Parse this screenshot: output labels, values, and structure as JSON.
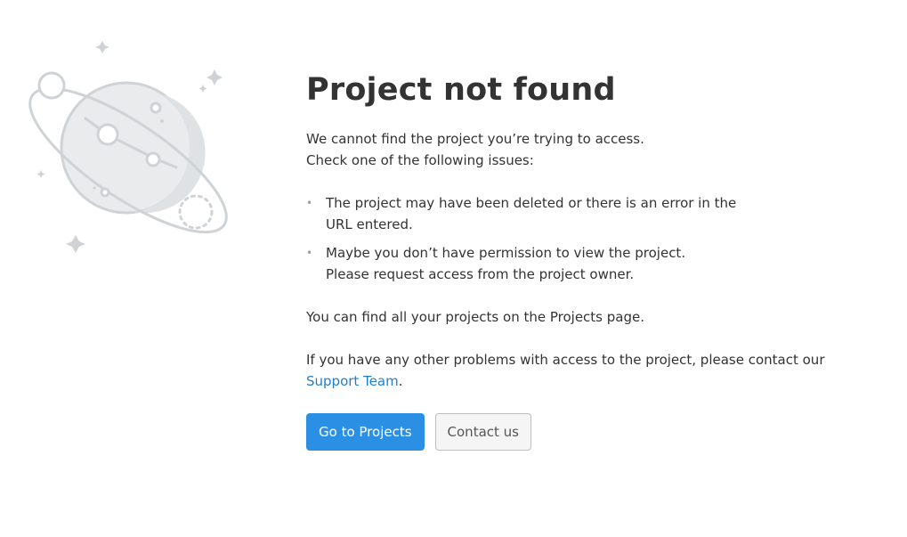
{
  "page": {
    "title": "Project not found",
    "intro_line1": "We cannot find the project you’re trying to access.",
    "intro_line2": "Check one of the following issues:",
    "issues": [
      {
        "line1": "The project may have been deleted or there is an error in the",
        "line2": "URL entered."
      },
      {
        "line1": "Maybe you don’t have permission to view the project.",
        "line2": "Please request access from the project owner."
      }
    ],
    "projects_note": "You can find all your projects on the Projects page.",
    "contact_text": "If you have any other problems with access to the project, please contact our ",
    "support_link": "Support Team",
    "contact_end": "."
  },
  "actions": {
    "primary_label": "Go to Projects",
    "secondary_label": "Contact us"
  },
  "illustration": {
    "icon": "planet-illustration-icon"
  },
  "colors": {
    "primary": "#2b90e3",
    "link": "#1e7fce",
    "text": "#333333",
    "illustration": "#cfd3d6"
  }
}
